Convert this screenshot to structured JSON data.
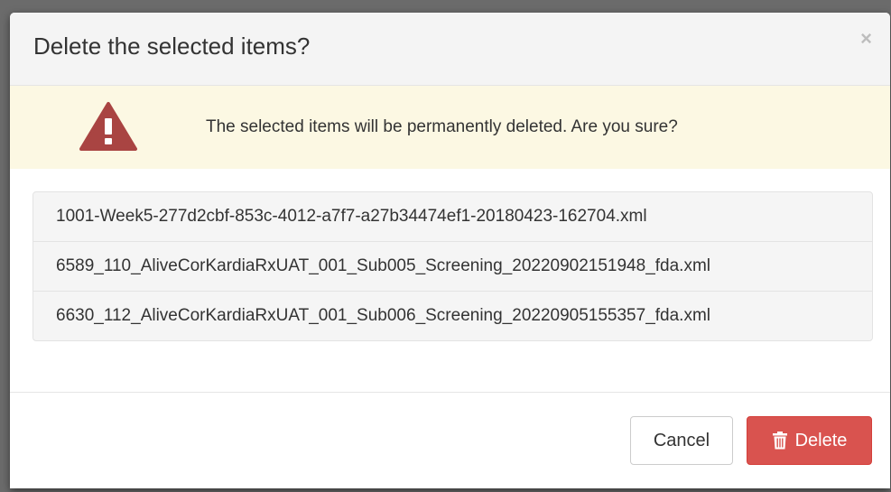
{
  "dialog": {
    "title": "Delete the selected items?",
    "close_glyph": "×"
  },
  "warning": {
    "icon": "warning-triangle-icon",
    "message": "The selected items will be permanently deleted. Are you sure?",
    "color": "#a94442"
  },
  "items": [
    "1001-Week5-277d2cbf-853c-4012-a7f7-a27b34474ef1-20180423-162704.xml",
    "6589_110_AliveCorKardiaRxUAT_001_Sub005_Screening_20220902151948_fda.xml",
    "6630_112_AliveCorKardiaRxUAT_001_Sub006_Screening_20220905155357_fda.xml"
  ],
  "footer": {
    "cancel_label": "Cancel",
    "delete_label": "Delete",
    "delete_icon": "trash-icon",
    "delete_color": "#d9534f"
  }
}
